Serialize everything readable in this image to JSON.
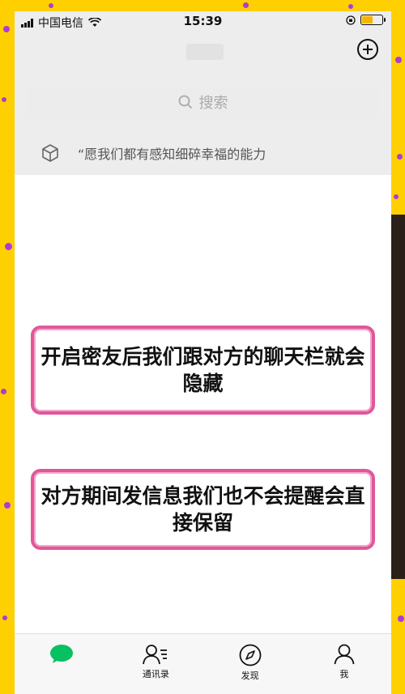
{
  "status_bar": {
    "carrier": "中国电信",
    "time": "15:39"
  },
  "search": {
    "placeholder": "搜索"
  },
  "pinned_message": {
    "text": "“愿我们都有感知细碎幸福的能力"
  },
  "overlay_captions": [
    "开启密友后我们跟对方的聊天栏就会隐藏",
    "对方期间发信息我们也不会提醒会直接保留"
  ],
  "tab_bar": {
    "tabs": [
      {
        "label": "",
        "icon": "chat-bubble-icon",
        "active": true
      },
      {
        "label": "通讯录",
        "icon": "contacts-icon"
      },
      {
        "label": "发现",
        "icon": "compass-icon"
      },
      {
        "label": "我",
        "icon": "person-icon"
      }
    ]
  },
  "colors": {
    "background_frame": "#ffd000",
    "confetti": "#b03ad6",
    "caption_border": "#e0589a",
    "wechat_green": "#07c160",
    "header_gray": "#ededed"
  }
}
